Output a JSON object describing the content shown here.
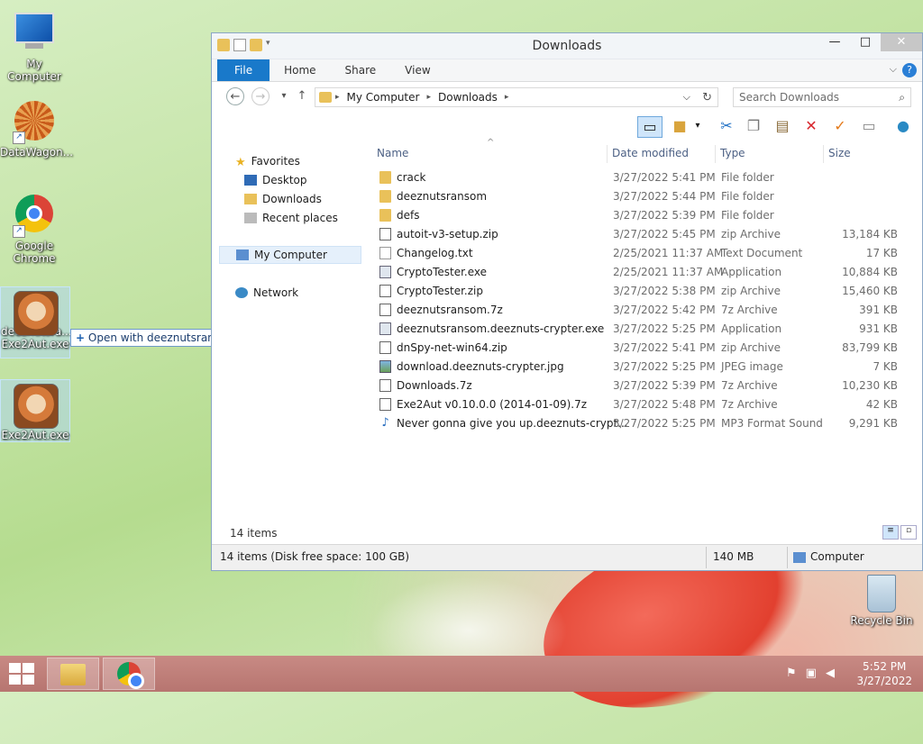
{
  "desktop": {
    "icons": [
      {
        "label": "My Computer"
      },
      {
        "label": "DataWagon..."
      },
      {
        "label": "Google Chrome"
      },
      {
        "label": "deeznutsra...",
        "label2": "Exe2Aut.exe"
      },
      {
        "label": "Exe2Aut.exe"
      },
      {
        "label": "Recycle Bin"
      }
    ],
    "drag_tooltip": "Open with deeznutsransom.exe",
    "drag_tooltip_symbol": "+"
  },
  "window": {
    "title": "Downloads",
    "controls": {
      "minimize": "—",
      "maximize": "□",
      "close": "✕"
    },
    "ribbon": {
      "file": "File",
      "tabs": [
        "Home",
        "Share",
        "View"
      ],
      "help": "?",
      "expand": "⌵"
    },
    "nav": {
      "back": "←",
      "forward": "→",
      "recent": "▾",
      "up": "↑"
    },
    "address": {
      "crumbs": [
        "My Computer",
        "Downloads"
      ],
      "dropdown": "⌵",
      "refresh": "↻"
    },
    "search": {
      "placeholder": "Search Downloads",
      "icon": "⌕"
    },
    "nav_pane": {
      "favorites": "Favorites",
      "desktop": "Desktop",
      "downloads": "Downloads",
      "recent": "Recent places",
      "computer": "My Computer",
      "network": "Network"
    },
    "columns": {
      "name": "Name",
      "date": "Date modified",
      "type": "Type",
      "size": "Size",
      "sort_arrow": "^"
    },
    "files": [
      {
        "name": "crack",
        "date": "3/27/2022 5:41 PM",
        "type": "File folder",
        "size": "",
        "icon": "folder"
      },
      {
        "name": "deeznutsransom",
        "date": "3/27/2022 5:44 PM",
        "type": "File folder",
        "size": "",
        "icon": "folder"
      },
      {
        "name": "defs",
        "date": "3/27/2022 5:39 PM",
        "type": "File folder",
        "size": "",
        "icon": "folder"
      },
      {
        "name": "autoit-v3-setup.zip",
        "date": "3/27/2022 5:45 PM",
        "type": "zip Archive",
        "size": "13,184 KB",
        "icon": "zip"
      },
      {
        "name": "Changelog.txt",
        "date": "2/25/2021 11:37 AM",
        "type": "Text Document",
        "size": "17 KB",
        "icon": "txt"
      },
      {
        "name": "CryptoTester.exe",
        "date": "2/25/2021 11:37 AM",
        "type": "Application",
        "size": "10,884 KB",
        "icon": "exe"
      },
      {
        "name": "CryptoTester.zip",
        "date": "3/27/2022 5:38 PM",
        "type": "zip Archive",
        "size": "15,460 KB",
        "icon": "zip"
      },
      {
        "name": "deeznutsransom.7z",
        "date": "3/27/2022 5:42 PM",
        "type": "7z Archive",
        "size": "391 KB",
        "icon": "zip"
      },
      {
        "name": "deeznutsransom.deeznuts-crypter.exe",
        "date": "3/27/2022 5:25 PM",
        "type": "Application",
        "size": "931 KB",
        "icon": "exe"
      },
      {
        "name": "dnSpy-net-win64.zip",
        "date": "3/27/2022 5:41 PM",
        "type": "zip Archive",
        "size": "83,799 KB",
        "icon": "zip"
      },
      {
        "name": "download.deeznuts-crypter.jpg",
        "date": "3/27/2022 5:25 PM",
        "type": "JPEG image",
        "size": "7 KB",
        "icon": "jpg"
      },
      {
        "name": "Downloads.7z",
        "date": "3/27/2022 5:39 PM",
        "type": "7z Archive",
        "size": "10,230 KB",
        "icon": "zip"
      },
      {
        "name": "Exe2Aut v0.10.0.0 (2014-01-09).7z",
        "date": "3/27/2022 5:48 PM",
        "type": "7z Archive",
        "size": "42 KB",
        "icon": "zip"
      },
      {
        "name": "Never gonna give you up.deeznuts-crypt...",
        "date": "3/27/2022 5:25 PM",
        "type": "MP3 Format Sound",
        "size": "9,291 KB",
        "icon": "mp3"
      }
    ],
    "item_count": "14 items",
    "status": {
      "left": "14 items (Disk free space: 100 GB)",
      "size": "140 MB",
      "location": "Computer"
    }
  },
  "taskbar": {
    "time": "5:52 PM",
    "date": "3/27/2022"
  }
}
